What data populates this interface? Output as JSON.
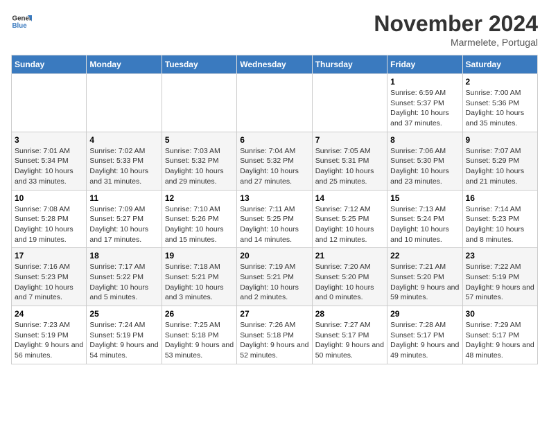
{
  "header": {
    "logo": {
      "general": "General",
      "blue": "Blue"
    },
    "title": "November 2024",
    "location": "Marmelete, Portugal"
  },
  "weekdays": [
    "Sunday",
    "Monday",
    "Tuesday",
    "Wednesday",
    "Thursday",
    "Friday",
    "Saturday"
  ],
  "weeks": [
    [
      null,
      null,
      null,
      null,
      null,
      {
        "day": "1",
        "sunrise": "Sunrise: 6:59 AM",
        "sunset": "Sunset: 5:37 PM",
        "daylight": "Daylight: 10 hours and 37 minutes."
      },
      {
        "day": "2",
        "sunrise": "Sunrise: 7:00 AM",
        "sunset": "Sunset: 5:36 PM",
        "daylight": "Daylight: 10 hours and 35 minutes."
      }
    ],
    [
      {
        "day": "3",
        "sunrise": "Sunrise: 7:01 AM",
        "sunset": "Sunset: 5:34 PM",
        "daylight": "Daylight: 10 hours and 33 minutes."
      },
      {
        "day": "4",
        "sunrise": "Sunrise: 7:02 AM",
        "sunset": "Sunset: 5:33 PM",
        "daylight": "Daylight: 10 hours and 31 minutes."
      },
      {
        "day": "5",
        "sunrise": "Sunrise: 7:03 AM",
        "sunset": "Sunset: 5:32 PM",
        "daylight": "Daylight: 10 hours and 29 minutes."
      },
      {
        "day": "6",
        "sunrise": "Sunrise: 7:04 AM",
        "sunset": "Sunset: 5:32 PM",
        "daylight": "Daylight: 10 hours and 27 minutes."
      },
      {
        "day": "7",
        "sunrise": "Sunrise: 7:05 AM",
        "sunset": "Sunset: 5:31 PM",
        "daylight": "Daylight: 10 hours and 25 minutes."
      },
      {
        "day": "8",
        "sunrise": "Sunrise: 7:06 AM",
        "sunset": "Sunset: 5:30 PM",
        "daylight": "Daylight: 10 hours and 23 minutes."
      },
      {
        "day": "9",
        "sunrise": "Sunrise: 7:07 AM",
        "sunset": "Sunset: 5:29 PM",
        "daylight": "Daylight: 10 hours and 21 minutes."
      }
    ],
    [
      {
        "day": "10",
        "sunrise": "Sunrise: 7:08 AM",
        "sunset": "Sunset: 5:28 PM",
        "daylight": "Daylight: 10 hours and 19 minutes."
      },
      {
        "day": "11",
        "sunrise": "Sunrise: 7:09 AM",
        "sunset": "Sunset: 5:27 PM",
        "daylight": "Daylight: 10 hours and 17 minutes."
      },
      {
        "day": "12",
        "sunrise": "Sunrise: 7:10 AM",
        "sunset": "Sunset: 5:26 PM",
        "daylight": "Daylight: 10 hours and 15 minutes."
      },
      {
        "day": "13",
        "sunrise": "Sunrise: 7:11 AM",
        "sunset": "Sunset: 5:25 PM",
        "daylight": "Daylight: 10 hours and 14 minutes."
      },
      {
        "day": "14",
        "sunrise": "Sunrise: 7:12 AM",
        "sunset": "Sunset: 5:25 PM",
        "daylight": "Daylight: 10 hours and 12 minutes."
      },
      {
        "day": "15",
        "sunrise": "Sunrise: 7:13 AM",
        "sunset": "Sunset: 5:24 PM",
        "daylight": "Daylight: 10 hours and 10 minutes."
      },
      {
        "day": "16",
        "sunrise": "Sunrise: 7:14 AM",
        "sunset": "Sunset: 5:23 PM",
        "daylight": "Daylight: 10 hours and 8 minutes."
      }
    ],
    [
      {
        "day": "17",
        "sunrise": "Sunrise: 7:16 AM",
        "sunset": "Sunset: 5:23 PM",
        "daylight": "Daylight: 10 hours and 7 minutes."
      },
      {
        "day": "18",
        "sunrise": "Sunrise: 7:17 AM",
        "sunset": "Sunset: 5:22 PM",
        "daylight": "Daylight: 10 hours and 5 minutes."
      },
      {
        "day": "19",
        "sunrise": "Sunrise: 7:18 AM",
        "sunset": "Sunset: 5:21 PM",
        "daylight": "Daylight: 10 hours and 3 minutes."
      },
      {
        "day": "20",
        "sunrise": "Sunrise: 7:19 AM",
        "sunset": "Sunset: 5:21 PM",
        "daylight": "Daylight: 10 hours and 2 minutes."
      },
      {
        "day": "21",
        "sunrise": "Sunrise: 7:20 AM",
        "sunset": "Sunset: 5:20 PM",
        "daylight": "Daylight: 10 hours and 0 minutes."
      },
      {
        "day": "22",
        "sunrise": "Sunrise: 7:21 AM",
        "sunset": "Sunset: 5:20 PM",
        "daylight": "Daylight: 9 hours and 59 minutes."
      },
      {
        "day": "23",
        "sunrise": "Sunrise: 7:22 AM",
        "sunset": "Sunset: 5:19 PM",
        "daylight": "Daylight: 9 hours and 57 minutes."
      }
    ],
    [
      {
        "day": "24",
        "sunrise": "Sunrise: 7:23 AM",
        "sunset": "Sunset: 5:19 PM",
        "daylight": "Daylight: 9 hours and 56 minutes."
      },
      {
        "day": "25",
        "sunrise": "Sunrise: 7:24 AM",
        "sunset": "Sunset: 5:19 PM",
        "daylight": "Daylight: 9 hours and 54 minutes."
      },
      {
        "day": "26",
        "sunrise": "Sunrise: 7:25 AM",
        "sunset": "Sunset: 5:18 PM",
        "daylight": "Daylight: 9 hours and 53 minutes."
      },
      {
        "day": "27",
        "sunrise": "Sunrise: 7:26 AM",
        "sunset": "Sunset: 5:18 PM",
        "daylight": "Daylight: 9 hours and 52 minutes."
      },
      {
        "day": "28",
        "sunrise": "Sunrise: 7:27 AM",
        "sunset": "Sunset: 5:17 PM",
        "daylight": "Daylight: 9 hours and 50 minutes."
      },
      {
        "day": "29",
        "sunrise": "Sunrise: 7:28 AM",
        "sunset": "Sunset: 5:17 PM",
        "daylight": "Daylight: 9 hours and 49 minutes."
      },
      {
        "day": "30",
        "sunrise": "Sunrise: 7:29 AM",
        "sunset": "Sunset: 5:17 PM",
        "daylight": "Daylight: 9 hours and 48 minutes."
      }
    ]
  ]
}
